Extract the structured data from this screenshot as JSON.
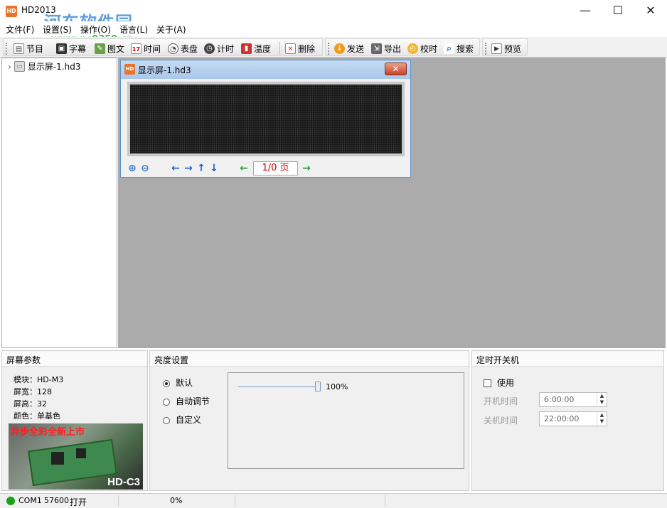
{
  "window": {
    "title": "HD2013",
    "icon_text": "HD",
    "minimize": "—",
    "maximize": "☐",
    "close": "✕"
  },
  "watermark": {
    "line1": "河东软件园",
    "line2": "www.pc0359.cn"
  },
  "menu": [
    "文件(F)",
    "设置(S)",
    "操作(O)",
    "语言(L)",
    "关于(A)"
  ],
  "toolbar": {
    "program": "节目",
    "subtitle": "字幕",
    "imagetext": "图文",
    "time": "时间",
    "clock": "表盘",
    "timer": "计时",
    "temperature": "温度",
    "delete": "删除",
    "send": "发送",
    "export": "导出",
    "calibrate": "校时",
    "search": "搜索",
    "preview": "预览"
  },
  "tree": {
    "expand": "›",
    "item": "显示屏-1.hd3"
  },
  "child_window": {
    "title": "显示屏-1.hd3",
    "close": "✕",
    "page": "1/0 页"
  },
  "screen_params": {
    "header": "屏幕参数",
    "module": "模块：HD-M3",
    "width": "屏宽：128",
    "height": "屏高：32",
    "color": "颜色：单基色",
    "promo_text": "异步全彩全新上市",
    "promo_model": "HD-C3"
  },
  "brightness": {
    "header": "亮度设置",
    "options": [
      "默认",
      "自动调节",
      "自定义"
    ],
    "selected_index": 0,
    "slider_value": "100%",
    "level": 1.0
  },
  "timer_power": {
    "header": "定时开关机",
    "use_label": "使用",
    "on_label": "开机时间",
    "on_value": "6:00:00",
    "off_label": "关机时间",
    "off_value": "22:00:00"
  },
  "status": {
    "port": "COM1",
    "baud": "57600",
    "state": "打开",
    "progress": "0%"
  },
  "colors": {
    "accent": "#2a7fd4",
    "status_dot": "#1aa01a",
    "page_text": "#cc0000",
    "nav_arrow": "#1a5fc8",
    "nav_green": "#22a022"
  }
}
